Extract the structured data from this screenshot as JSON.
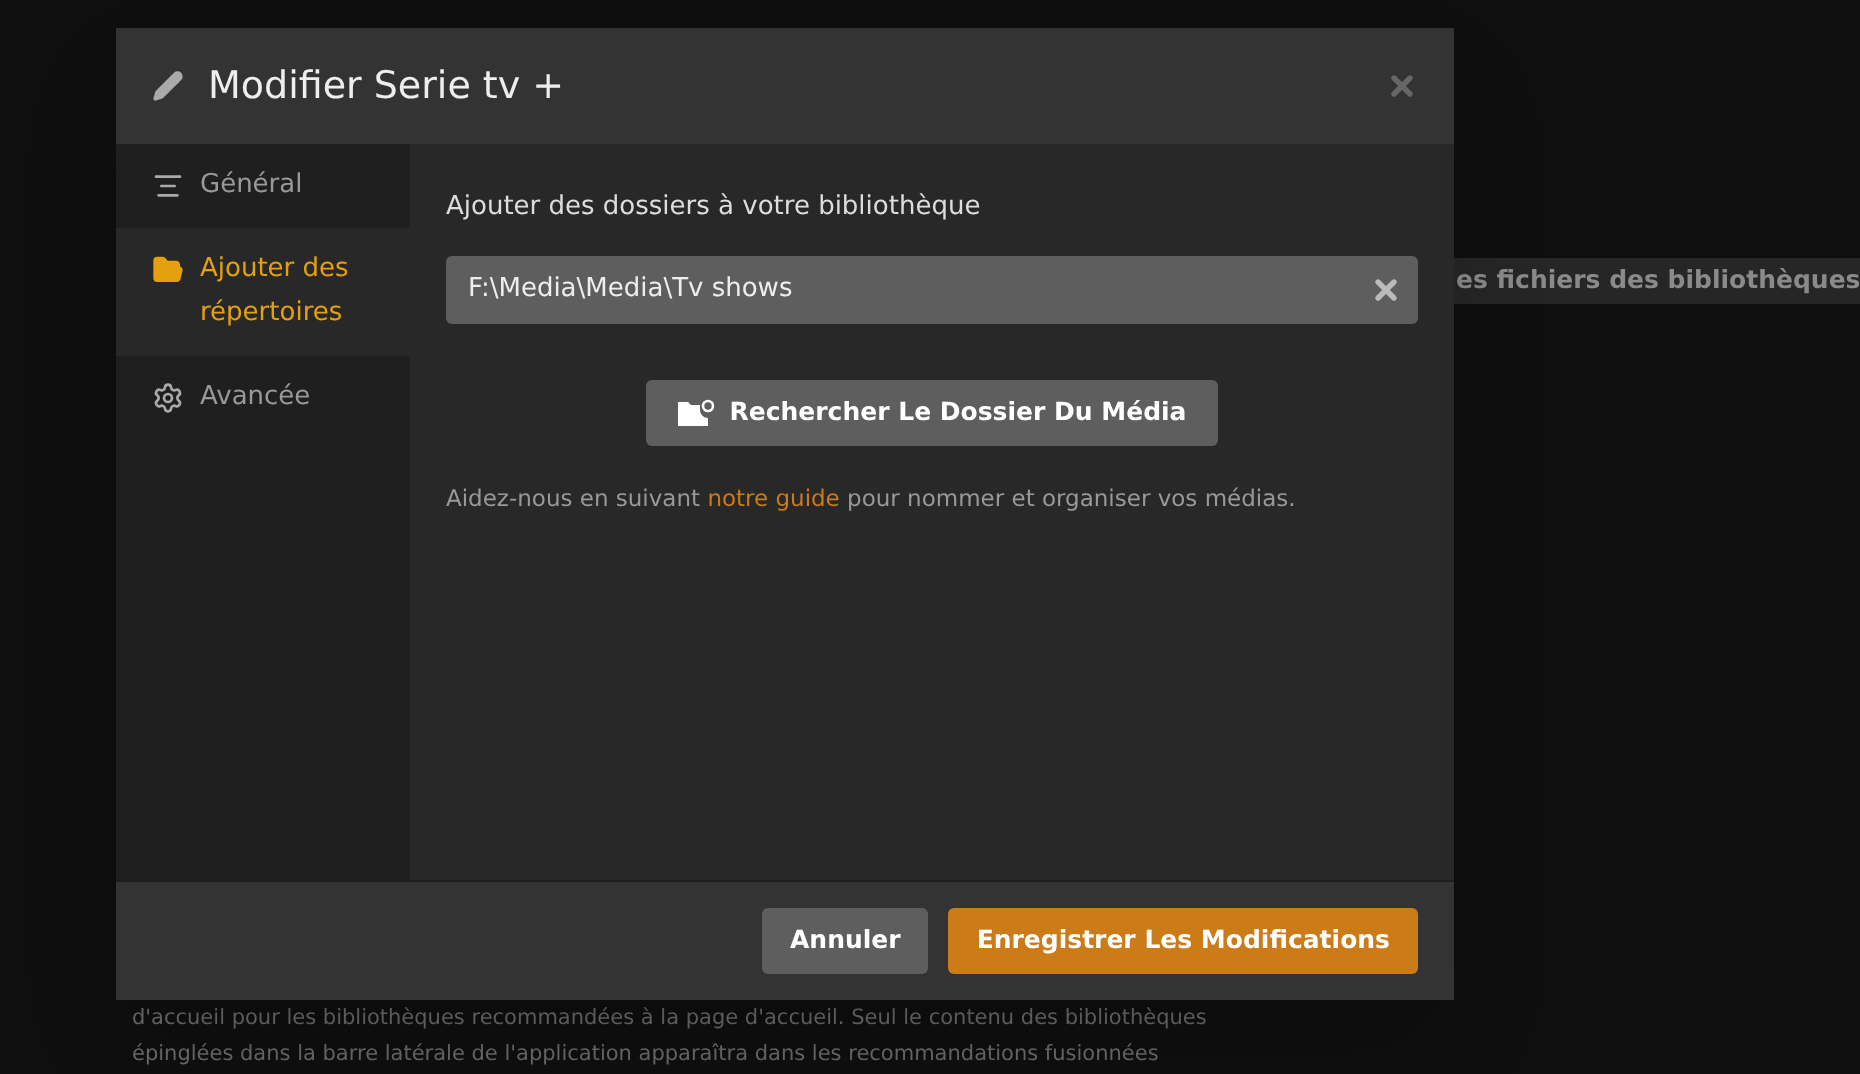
{
  "background": {
    "heading": "es fichiers des bibliothèques",
    "paragraph_lines": [
      "d'accueil pour les bibliothèques recommandées à la page d'accueil. Seul le contenu des bibliothèques",
      "épinglées dans la barre latérale de l'application apparaîtra dans les recommandations fusionnées"
    ]
  },
  "dialog": {
    "title": "Modifier Serie tv +",
    "sidebar": [
      {
        "kind": "general",
        "label": "Général",
        "selected": false
      },
      {
        "kind": "folders",
        "label": "Ajouter des répertoires",
        "selected": true
      },
      {
        "kind": "advanced",
        "label": "Avancée",
        "selected": false
      }
    ],
    "section_label": "Ajouter des dossiers à votre bibliothèque",
    "folder_path": "F:\\Media\\Media\\Tv shows",
    "browse_button": "Rechercher Le Dossier Du Média",
    "help": {
      "before": "Aidez-nous en suivant ",
      "link": "notre guide",
      "after": " pour nommer et organiser vos médias."
    },
    "buttons": [
      {
        "kind": "secondary",
        "label": "Annuler"
      },
      {
        "kind": "primary",
        "label": "Enregistrer Les Modifications"
      }
    ]
  }
}
